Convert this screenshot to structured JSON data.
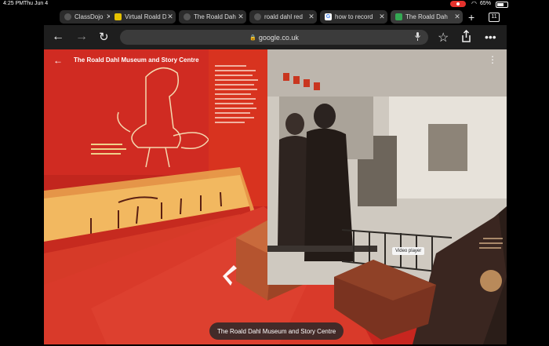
{
  "status_bar": {
    "time": "4:25 PM",
    "date": "Thu Jun 4",
    "battery": "65%"
  },
  "tabs": [
    {
      "label": "ClassDojo fo",
      "favicon": "globe-icon",
      "active": false
    },
    {
      "label": "Virtual Roald D",
      "favicon": "page-icon",
      "active": false
    },
    {
      "label": "The Roald Dah",
      "favicon": "globe-icon",
      "active": false
    },
    {
      "label": "roald dahl red",
      "favicon": "globe-icon",
      "active": false
    },
    {
      "label": "how to record",
      "favicon": "google-icon",
      "active": false
    },
    {
      "label": "The Roald Dah",
      "favicon": "maps-icon",
      "active": true
    }
  ],
  "tab_count": "11",
  "address_bar": {
    "url": "google.co.uk"
  },
  "viewer": {
    "title": "The Roald Dahl Museum and Story Centre",
    "tooltip": "Video player",
    "place_chip": "The Roald Dahl Museum and Story Centre"
  },
  "colors": {
    "wall_red": "#c8261f",
    "floor_red": "#d93a2a",
    "display_glow": "#f2b860"
  }
}
